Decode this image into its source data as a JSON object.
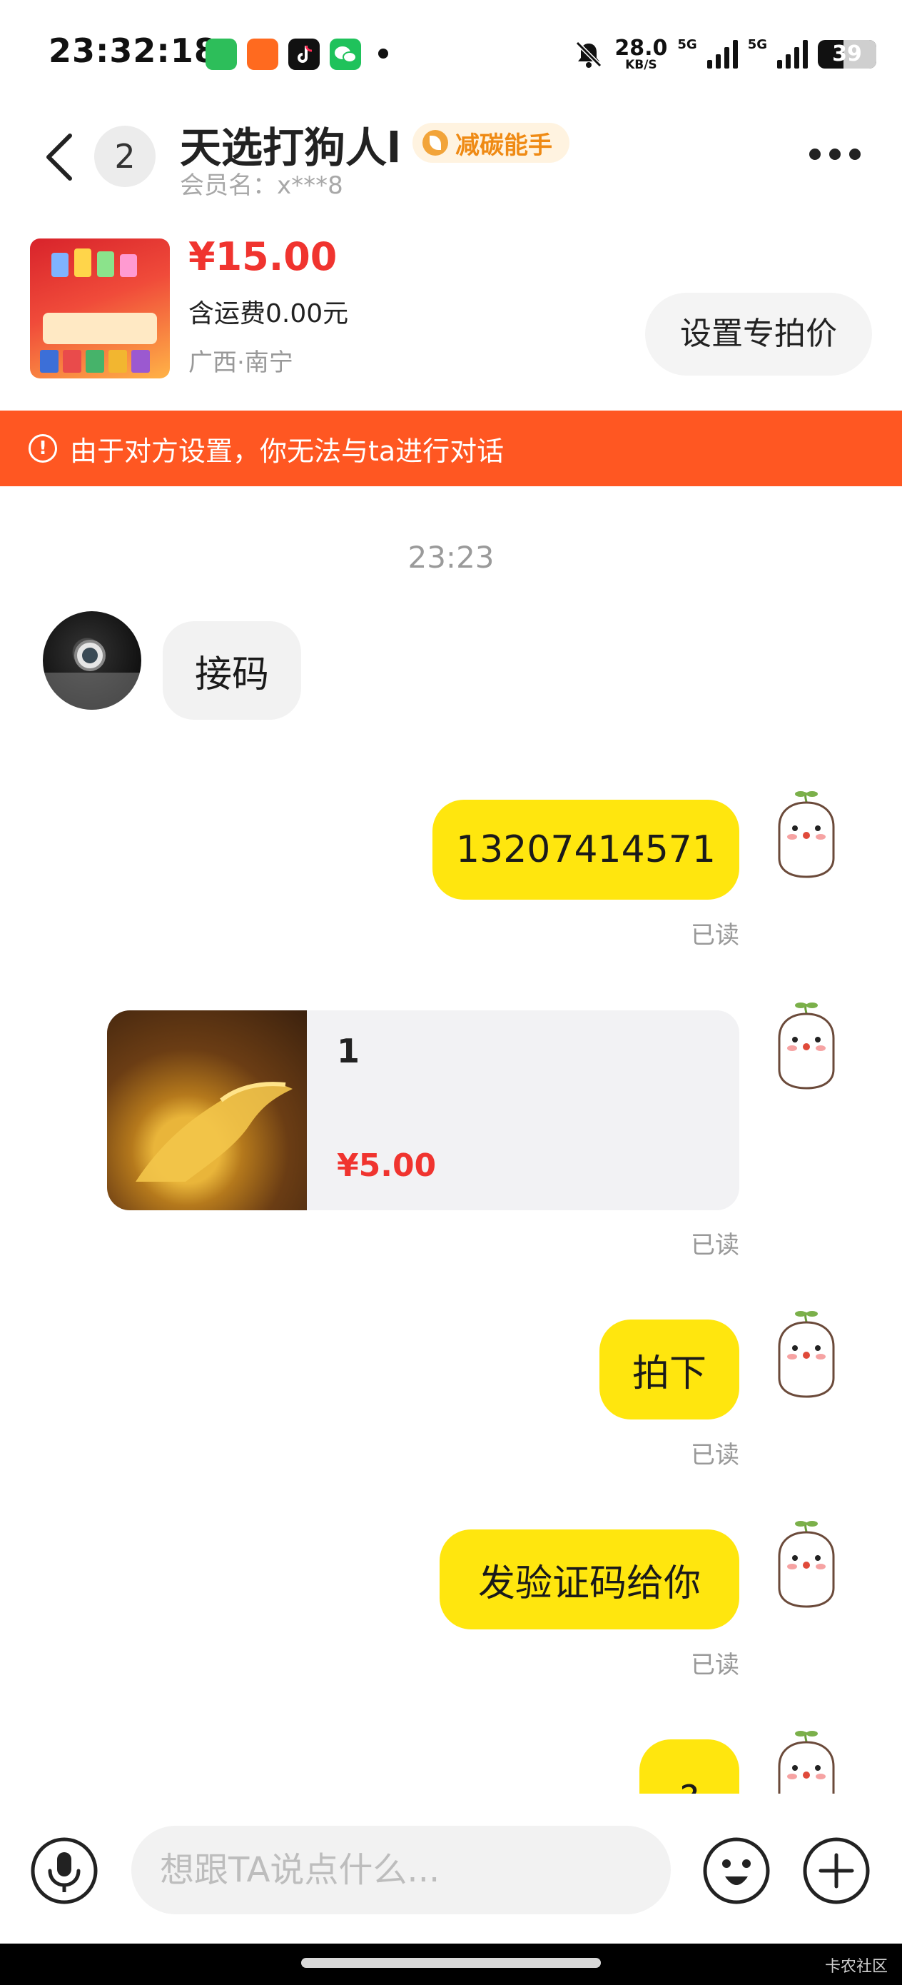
{
  "status_bar": {
    "time": "23:32:18",
    "speed_value": "28.0",
    "speed_unit": "KB/S",
    "network_1": "5G",
    "network_2": "5G",
    "battery": "39"
  },
  "header": {
    "unread_count": "2",
    "title": "天选打狗人l",
    "badge": "减碳能手",
    "member_name": "会员名：x***8"
  },
  "product": {
    "price": "¥15.00",
    "shipping": "含运费0.00元",
    "location": "广西·南宁",
    "special_price_button": "设置专拍价"
  },
  "warning": {
    "text": "由于对方设置，你无法与ta进行对话"
  },
  "chat": {
    "time_divider": "23:23",
    "messages": [
      {
        "side": "left",
        "text": "接码"
      },
      {
        "side": "right",
        "text": "13207414571",
        "status": "已读"
      },
      {
        "side": "right",
        "type": "goods",
        "title": "1",
        "price": "¥5.00",
        "status": "已读"
      },
      {
        "side": "right",
        "text": "拍下",
        "status": "已读"
      },
      {
        "side": "right",
        "text": "发验证码给你",
        "status": "已读"
      },
      {
        "side": "right",
        "text": "?"
      }
    ]
  },
  "input": {
    "placeholder": "想跟TA说点什么..."
  },
  "watermark": "卡农社区",
  "colors": {
    "accent_yellow": "#ffe60e",
    "warning_orange": "#ff5722",
    "price_red": "#f0342f"
  }
}
